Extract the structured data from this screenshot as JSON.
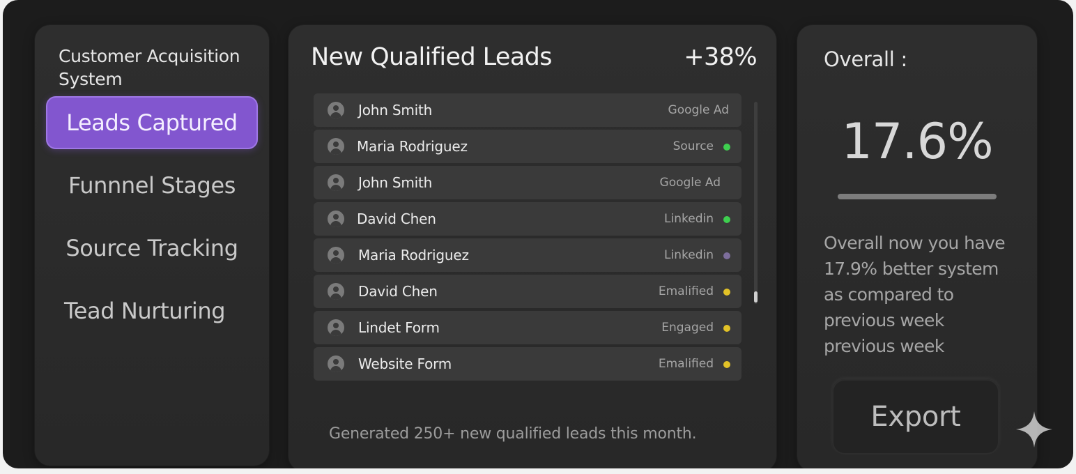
{
  "sidebar": {
    "app_title": "Customer Acquisition System",
    "items": [
      {
        "label": "Leads Captured",
        "active": true
      },
      {
        "label": "Funnnel Stages",
        "active": false
      },
      {
        "label": "Source Tracking",
        "active": false
      },
      {
        "label": "Tead Nurturing",
        "active": false
      }
    ]
  },
  "leads": {
    "title": "New Qualified Leads",
    "change": "+38%",
    "rows": [
      {
        "name": "John Smith",
        "source": "Google Ad",
        "status_color": ""
      },
      {
        "name": "Maria Rodriguez",
        "source": "Source",
        "status_color": "#3ecf4f"
      },
      {
        "name": "John Smith",
        "source": "Google Ad",
        "status_color": ""
      },
      {
        "name": "David Chen",
        "source": "Linkedin",
        "status_color": "#3ecf4f"
      },
      {
        "name": "Maria Rodriguez",
        "source": "Linkedin",
        "status_color": "#7d6e9c"
      },
      {
        "name": "David Chen",
        "source": "Emalified",
        "status_color": "#e2c227"
      },
      {
        "name": "Lindet Form",
        "source": "Engaged",
        "status_color": "#e2c227"
      },
      {
        "name": "Website Form",
        "source": "Emalified",
        "status_color": "#e2c227"
      }
    ],
    "footer": "Generated 250+ new qualified leads this month."
  },
  "overall": {
    "label": "Overall :",
    "value": "17.6%",
    "description": "Overall now you have 17.9% better system as compared to previous week previous week",
    "export_label": "Export"
  },
  "colors": {
    "accent": "#8256cf",
    "background": "#1c1c1c",
    "panel": "#2b2b2b"
  },
  "icons": {
    "avatar": "user-avatar-icon",
    "sparkle": "sparkle-icon"
  }
}
